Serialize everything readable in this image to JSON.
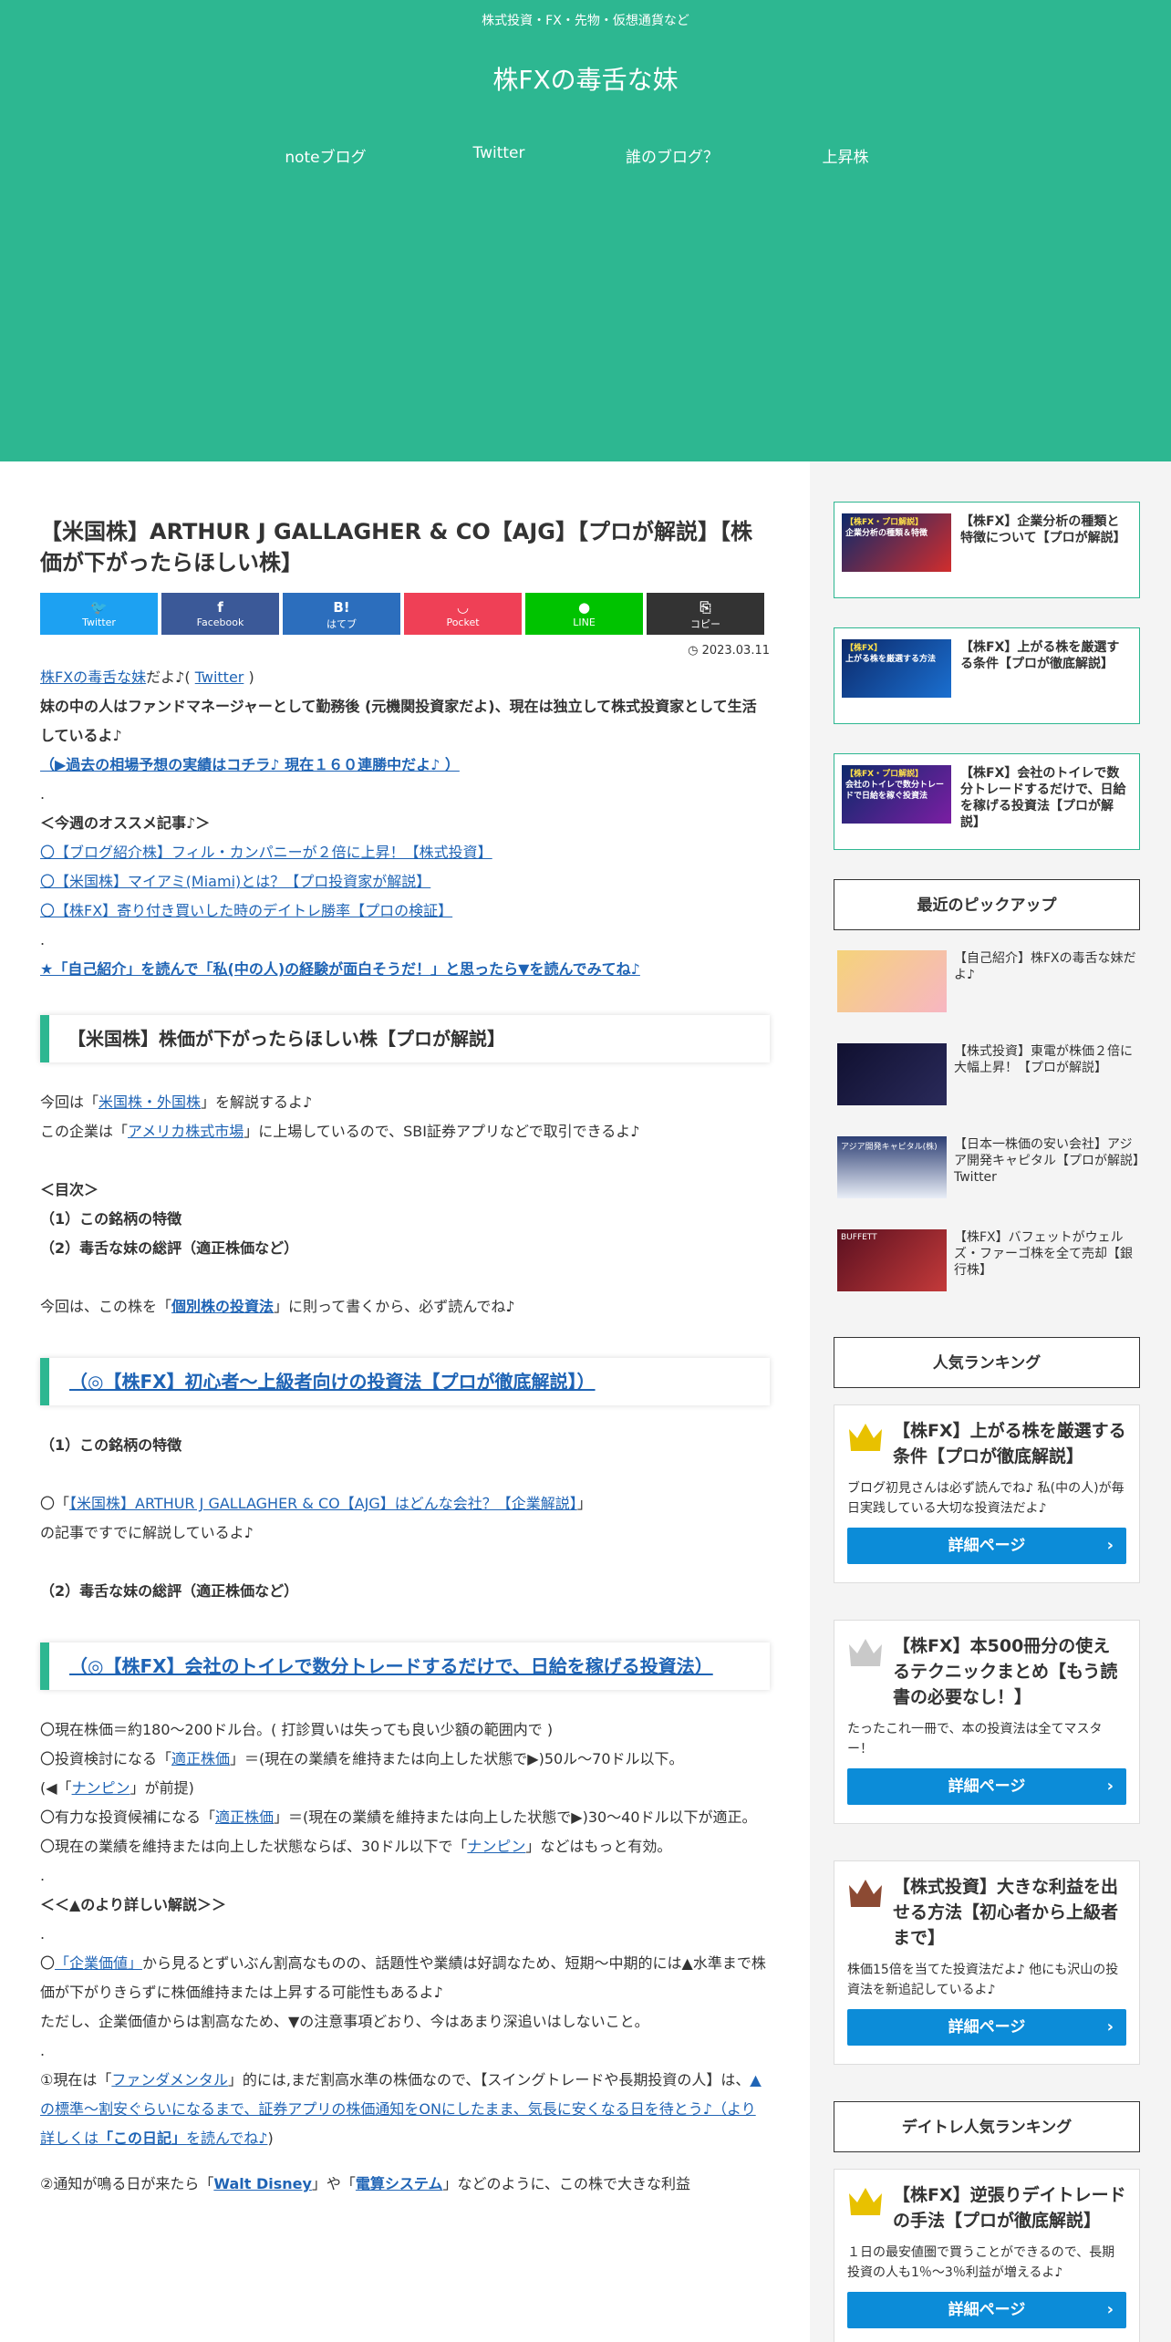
{
  "header": {
    "tagline": "株式投資・FX・先物・仮想通貨など",
    "site_title": "株FXの毒舌な妹",
    "nav": [
      "noteブログ",
      "Twitter",
      "誰のブログ？",
      "上昇株"
    ]
  },
  "article": {
    "title": "【米国株】ARTHUR J GALLAGHER & CO【AJG】【プロが解説】【株価が下がったらほしい株】",
    "share": [
      {
        "label": "Twitter",
        "icon": "twitter-icon",
        "glyph": "🐦",
        "color": "#1da1f2"
      },
      {
        "label": "Facebook",
        "icon": "facebook-icon",
        "glyph": "f",
        "color": "#3b5998"
      },
      {
        "label": "はてブ",
        "icon": "hatena-icon",
        "glyph": "B!",
        "color": "#2c6ebd"
      },
      {
        "label": "Pocket",
        "icon": "pocket-icon",
        "glyph": "◡",
        "color": "#ef4056"
      },
      {
        "label": "LINE",
        "icon": "line-icon",
        "glyph": "●",
        "color": "#00c300"
      },
      {
        "label": "コピー",
        "icon": "copy-icon",
        "glyph": "⎘",
        "color": "#333333"
      }
    ],
    "date": "2023.03.11",
    "intro": {
      "author_link": "株FXの毒舌な妹",
      "author_tail": "だよ♪(",
      "twitter_link": "Twitter",
      "close_paren": ")",
      "profile": "妹の中の人はファンドマネージャーとして勤務後 (元機関投資家だよ)、現在は独立して株式投資家として生活しているよ♪",
      "record_link": "（▶過去の相場予想の実績はコチラ♪ 現在１６０連勝中だよ♪ ）",
      "dot1": ".",
      "recommend_title": "＜今週のオススメ記事♪＞",
      "rec1": "〇【ブログ紹介株】フィル・カンパニーが２倍に上昇！【株式投資】",
      "rec2": "〇【米国株】マイアミ(Miami)とは？【プロ投資家が解説】",
      "rec3": "〇【株FX】寄り付き買いした時のデイトレ勝率【プロの検証】",
      "dot2": ".",
      "self_intro": "★「自己紹介」を読んで「私(中の人)の経験が面白そうだ！」と思ったら▼を読んでみてね♪"
    },
    "h2_1": "【米国株】株価が下がったらほしい株【プロが解説】",
    "sec1": {
      "l1_a": "今回は「",
      "l1_link": "米国株・外国株",
      "l1_b": "」を解説するよ♪",
      "l2_a": "この企業は「",
      "l2_link": "アメリカ株式市場",
      "l2_b": "」に上場しているので、SBI証券アプリなどで取引できるよ♪",
      "toc_title": "＜目次＞",
      "toc1": "（1）この銘柄の特徴",
      "toc2": "（2）毒舌な妹の総評（適正株価など）",
      "l3_a": "今回は、この株を「",
      "l3_link": "個別株の投資法",
      "l3_b": "」に則って書くから、必ず読んでね♪"
    },
    "h2_2": "（◎【株FX】初心者～上級者向けの投資法【プロが徹底解説】）",
    "sec2": {
      "title": "（1）この銘柄の特徴",
      "l1_a": "〇「",
      "l1_link": "【米国株】ARTHUR J GALLAGHER & CO【AJG】はどんな会社？【企業解説】",
      "l1_b": "」",
      "l2": "の記事ですでに解説しているよ♪",
      "title2": "（2）毒舌な妹の総評（適正株価など）"
    },
    "h2_3": "（◎【株FX】会社のトイレで数分トレードするだけで、日給を稼げる投資法）",
    "sec3": {
      "l1": "〇現在株価＝約180～200ドル台。( 打診買いは失っても良い少額の範囲内で )",
      "l2_a": "〇投資検討になる「",
      "l2_link": "適正株価",
      "l2_b": "」＝(現在の業績を維持または向上した状態で▶)50ル～70ドル以下。",
      "l3_a": "(◀「",
      "l3_link": "ナンピン",
      "l3_b": "」が前提)",
      "l4_a": "〇有力な投資候補になる「",
      "l4_link": "適正株価",
      "l4_b": "」＝(現在の業績を維持または向上した状態で▶)30～40ドル以下が適正。",
      "l5_a": "〇現在の業績を維持または向上した状態ならば、30ドル以下で「",
      "l5_link": "ナンピン",
      "l5_b": "」などはもっと有効。",
      "dot1": ".",
      "detail_title": "＜＜▲のより詳しい解説＞＞",
      "dot2": ".",
      "l6_a": "〇",
      "l6_link": "「企業価値」",
      "l6_b": "から見るとずいぶん割高なものの、話題性や業績は好調なため、短期～中期的には▲水準まで株価が下がりきらずに株価維持または上昇する可能性もあるよ♪",
      "l7": "ただし、企業価値からは割高なため、▼の注意事項どおり、今はあまり深追いはしないこと。",
      "dot3": ".",
      "l8_a": "①現在は「",
      "l8_link": "ファンダメンタル",
      "l8_b": "」的には,まだ割高水準の株価なので、【スイングトレードや長期投資の人】は、",
      "l8_link2": "▲の標準～割安ぐらいになるまで、証券アプリの株価通知をONにしたまま、気長に安くなる日を待とう♪（より詳しくは",
      "l8_link3": "「この日記」",
      "l8_link4": "を読んでね♪",
      "l8_c": ")",
      "l9_a": "②通知が鳴る日が来たら「",
      "l9_link": "Walt Disney",
      "l9_b": "」や「",
      "l9_link2": "電算システム",
      "l9_c": "」などのように、この株で大きな利益"
    }
  },
  "sidebar": {
    "cards": [
      {
        "text": "【株FX】企業分析の種類と特徴について【プロが解説】",
        "thumb": "企業分析の種類＆特徴",
        "thumb_tag": "【株FX・プロ解説】"
      },
      {
        "text": "【株FX】上がる株を厳選する条件【プロが徹底解説】",
        "thumb": "上がる株を厳選する方法",
        "thumb_tag": "【株FX】"
      },
      {
        "text": "【株FX】会社のトイレで数分トレードするだけで、日給を稼げる投資法【プロが解説】",
        "thumb": "会社のトイレで数分トレードで日給を稼ぐ投資法",
        "thumb_tag": "【株FX・プロ解説】"
      }
    ],
    "pickup_title": "最近のピックアップ",
    "pickups": [
      {
        "text": "【自己紹介】株FXの毒舌な妹だよ♪"
      },
      {
        "text": "【株式投資】東電が株価２倍に大幅上昇！【プロが解説】"
      },
      {
        "text": "【日本一株価の安い会社】アジア開発キャピタル【プロが解説】Twitter",
        "thumb_label": "アジア開発キャピタル(株)"
      },
      {
        "text": "【株FX】バフェットがウェルズ・ファーゴ株を全て売却【銀行株】",
        "thumb_label": "BUFFETT"
      }
    ],
    "ranking_title": "人気ランキング",
    "rankings": [
      {
        "title": "【株FX】上がる株を厳選する条件【プロが徹底解説】",
        "desc": "ブログ初見さんは必ず読んでね♪ 私(中の人)が毎日実践している大切な投資法だよ♪",
        "crown_color": "#e8c100"
      },
      {
        "title": "【株FX】本500冊分の使えるテクニックまとめ【もう読書の必要なし！】",
        "desc": "たったこれ一冊で、本の投資法は全てマスター！",
        "crown_color": "#c9c9c9"
      },
      {
        "title": "【株式投資】大きな利益を出せる方法【初心者から上級者まで】",
        "desc": "株価15倍を当てた投資法だよ♪ 他にも沢山の投資法を新追記しているよ♪",
        "crown_color": "#8c4a33"
      }
    ],
    "daytrade_title": "デイトレ人気ランキング",
    "daytrade": [
      {
        "title": "【株FX】逆張りデイトレードの手法【プロが徹底解説】",
        "desc": "１日の最安値圏で買うことができるので、長期投資の人も1％～3％利益が増えるよ♪",
        "crown_color": "#e8c100"
      }
    ],
    "more_label": "詳細ページ",
    "more_chevron": "›"
  }
}
